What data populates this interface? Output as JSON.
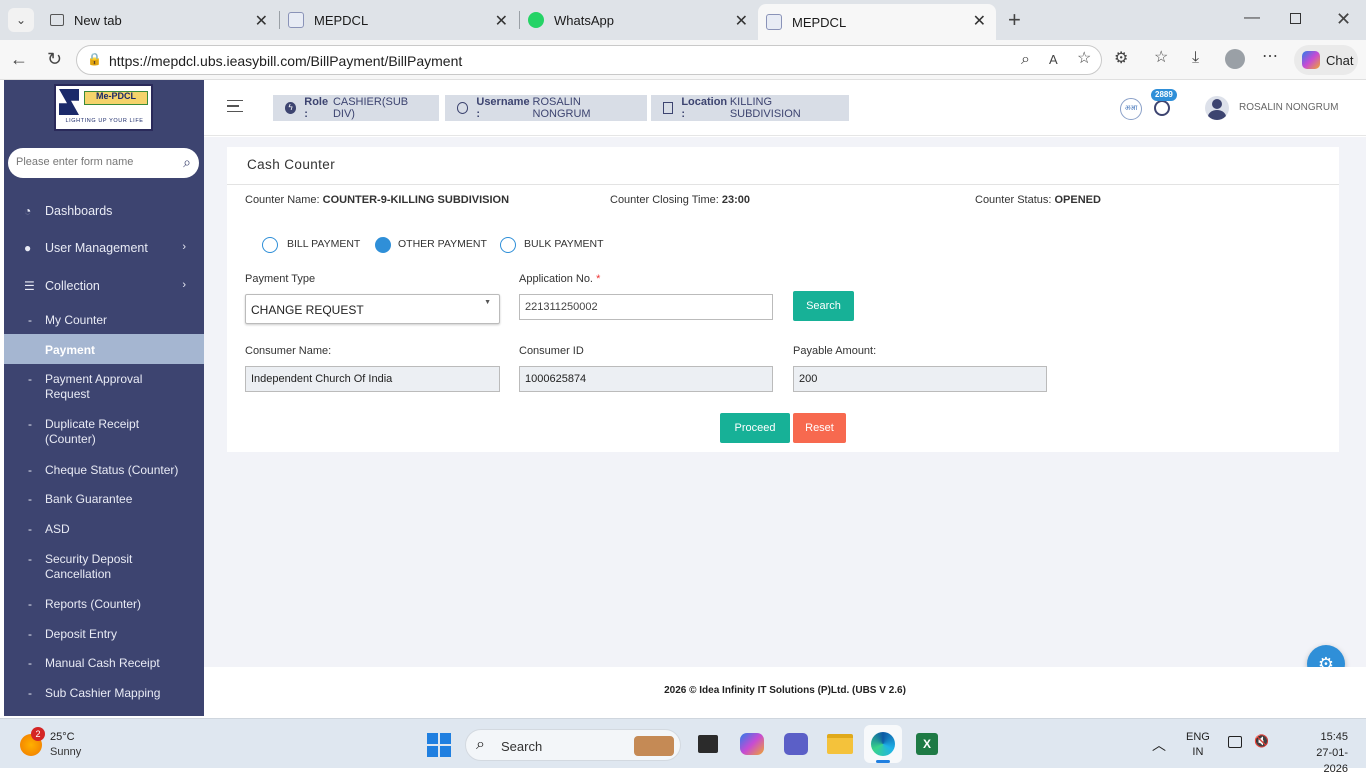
{
  "browser": {
    "tabs": [
      {
        "label": "New tab"
      },
      {
        "label": "MEPDCL"
      },
      {
        "label": "WhatsApp"
      },
      {
        "label": "MEPDCL"
      }
    ],
    "url": "https://mepdcl.ubs.ieasybill.com/BillPayment/BillPayment",
    "copilot_label": "Chat"
  },
  "sidebar": {
    "logo_text": "Me-PDCL",
    "logo_tagline": "LIGHTING UP YOUR LIFE",
    "search_placeholder": "Please enter form name",
    "items": [
      {
        "label": "Dashboards"
      },
      {
        "label": "User Management"
      },
      {
        "label": "Collection"
      }
    ],
    "sub_items": [
      {
        "label": "My Counter"
      },
      {
        "label": "Payment"
      },
      {
        "label": "Payment Approval Request"
      },
      {
        "label": "Duplicate Receipt (Counter)"
      },
      {
        "label": "Cheque Status (Counter)"
      },
      {
        "label": "Bank Guarantee"
      },
      {
        "label": "ASD"
      },
      {
        "label": "Security Deposit Cancellation"
      },
      {
        "label": "Reports (Counter)"
      },
      {
        "label": "Deposit Entry"
      },
      {
        "label": "Manual Cash Receipt"
      },
      {
        "label": "Sub Cashier Mapping"
      }
    ]
  },
  "header": {
    "role_label": "Role :",
    "role_value": "CASHIER(SUB DIV)",
    "username_label": "Username :",
    "username_value": "ROSALIN NONGRUM",
    "location_label": "Location :",
    "location_value": "KILLING SUBDIVISION",
    "notification_count": "2889",
    "user_name": "ROSALIN NONGRUM"
  },
  "page": {
    "title": "Cash Counter",
    "counter_name_label": "Counter Name:",
    "counter_name_value": "COUNTER-9-KILLING SUBDIVISION",
    "closing_time_label": "Counter Closing Time:",
    "closing_time_value": "23:00",
    "status_label": "Counter Status:",
    "status_value": "OPENED",
    "payment_modes": [
      {
        "label": "BILL PAYMENT",
        "selected": false
      },
      {
        "label": "OTHER PAYMENT",
        "selected": true
      },
      {
        "label": "BULK PAYMENT",
        "selected": false
      }
    ],
    "payment_type_label": "Payment Type",
    "payment_type_value": "CHANGE REQUEST",
    "application_no_label": "Application No.",
    "required_mark": "*",
    "application_no_value": "221311250002",
    "search_button": "Search",
    "consumer_name_label": "Consumer Name:",
    "consumer_name_value": "Independent Church Of India",
    "consumer_id_label": "Consumer ID",
    "consumer_id_value": "1000625874",
    "payable_amount_label": "Payable Amount:",
    "payable_amount_value": "200",
    "proceed_button": "Proceed",
    "reset_button": "Reset"
  },
  "footer": {
    "text": "2026 © Idea Infinity IT Solutions (P)Ltd. (UBS V 2.6)"
  },
  "taskbar": {
    "weather_badge": "2",
    "temperature": "25°C",
    "weather": "Sunny",
    "search_label": "Search",
    "language_top": "ENG",
    "language_bottom": "IN",
    "time": "15:45",
    "date": "27-01-2026"
  },
  "colors": {
    "sidebar_bg": "#3d4470",
    "active_item_bg": "#a5b6d1",
    "teal_button": "#17b197",
    "reset_button": "#f7694f",
    "radio_blue": "#2f8fd8"
  }
}
